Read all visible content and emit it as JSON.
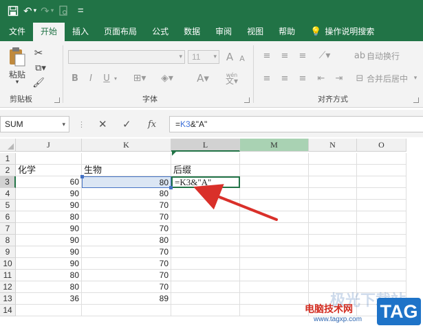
{
  "quick_access": {
    "more": "="
  },
  "tabs": [
    "文件",
    "开始",
    "插入",
    "页面布局",
    "公式",
    "数据",
    "审阅",
    "视图",
    "帮助",
    "操作说明搜索"
  ],
  "active_tab": "开始",
  "ribbon": {
    "clipboard": {
      "paste_label": "粘贴",
      "group_label": "剪贴板"
    },
    "font": {
      "size": "11",
      "group_label": "字体",
      "bold": "B",
      "italic": "I",
      "underline": "U",
      "grow": "A",
      "shrink": "A",
      "phonetic": "wén"
    },
    "alignment": {
      "wrap_text": "自动换行",
      "merge_center": "合并后居中",
      "group_label": "对齐方式"
    }
  },
  "formula_bar": {
    "name_box": "SUM",
    "fx": "fx",
    "formula_prefix": "=",
    "formula_ref": "K3",
    "formula_rest": "&\"A\""
  },
  "columns": [
    "J",
    "K",
    "L",
    "M",
    "N",
    "O"
  ],
  "rows": [
    "1",
    "2",
    "3",
    "4",
    "5",
    "6",
    "7",
    "8",
    "9",
    "10",
    "11",
    "12",
    "13",
    "14"
  ],
  "headers_row2": {
    "J": "化学",
    "K": "生物",
    "L": "后缀"
  },
  "active_cell_text": "=K3&\"A\"",
  "table": {
    "J": [
      60,
      90,
      90,
      80,
      90,
      90,
      90,
      90,
      80,
      80,
      36
    ],
    "K": [
      80,
      80,
      70,
      70,
      70,
      80,
      70,
      70,
      70,
      70,
      89
    ]
  },
  "watermark": {
    "site": "电脑技术网",
    "url": "www.tagxp.com",
    "tag": "TAG",
    "ghost": "极光下载站"
  },
  "colors": {
    "excel_green": "#217346",
    "ref_blue": "#4472c4",
    "arrow_red": "#d9302a"
  }
}
